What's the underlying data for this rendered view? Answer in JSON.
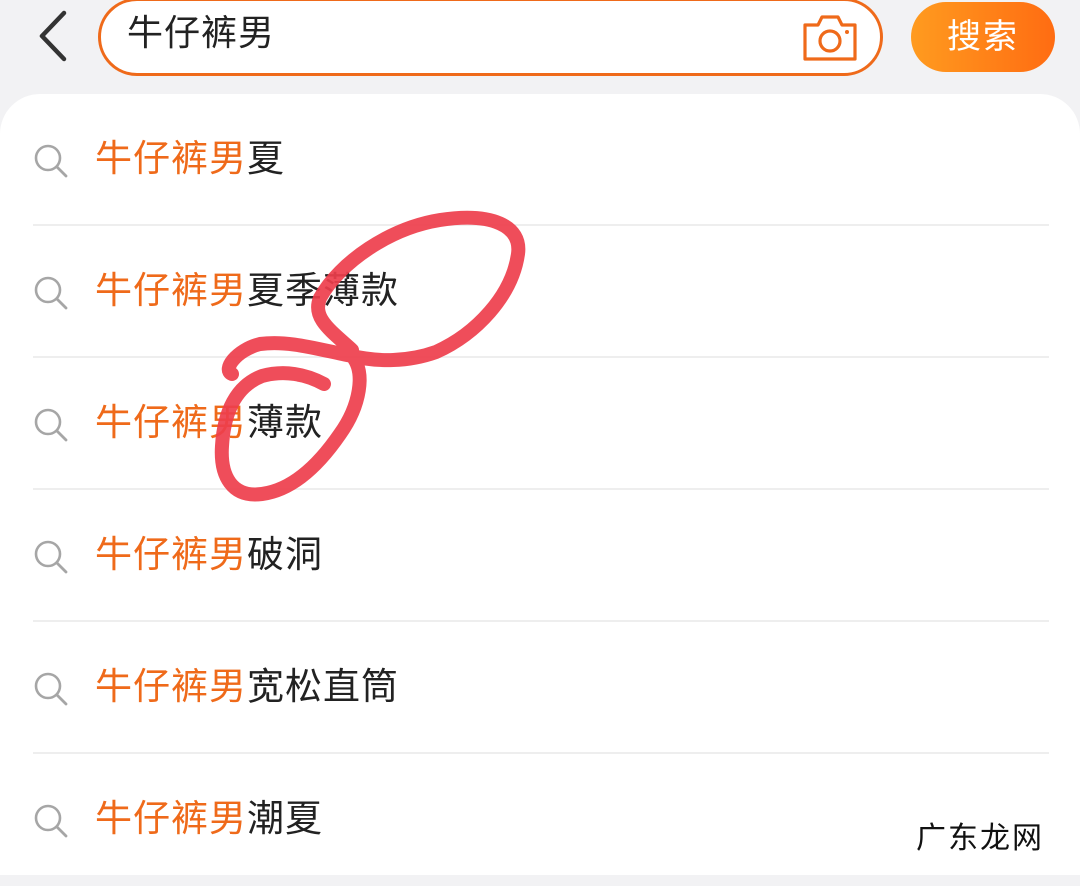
{
  "header": {
    "search_query": "牛仔裤男",
    "search_button_label": "搜索"
  },
  "suggestions": [
    {
      "highlight": "牛仔裤男",
      "rest": "夏"
    },
    {
      "highlight": "牛仔裤男",
      "rest": "夏季薄款"
    },
    {
      "highlight": "牛仔裤男",
      "rest": "薄款"
    },
    {
      "highlight": "牛仔裤男",
      "rest": "破洞"
    },
    {
      "highlight": "牛仔裤男",
      "rest": "宽松直筒"
    },
    {
      "highlight": "牛仔裤男",
      "rest": "潮夏"
    }
  ],
  "watermark": "广东龙网",
  "colors": {
    "accent": "#ef6a1a",
    "button_gradient_start": "#ff9b1f",
    "button_gradient_end": "#ff6c12",
    "annotation_stroke": "#ee3e4c",
    "text": "#222222",
    "background": "#f2f2f4"
  },
  "icons": {
    "back": "chevron-left-icon",
    "camera": "camera-icon",
    "suggestion": "search-icon"
  }
}
